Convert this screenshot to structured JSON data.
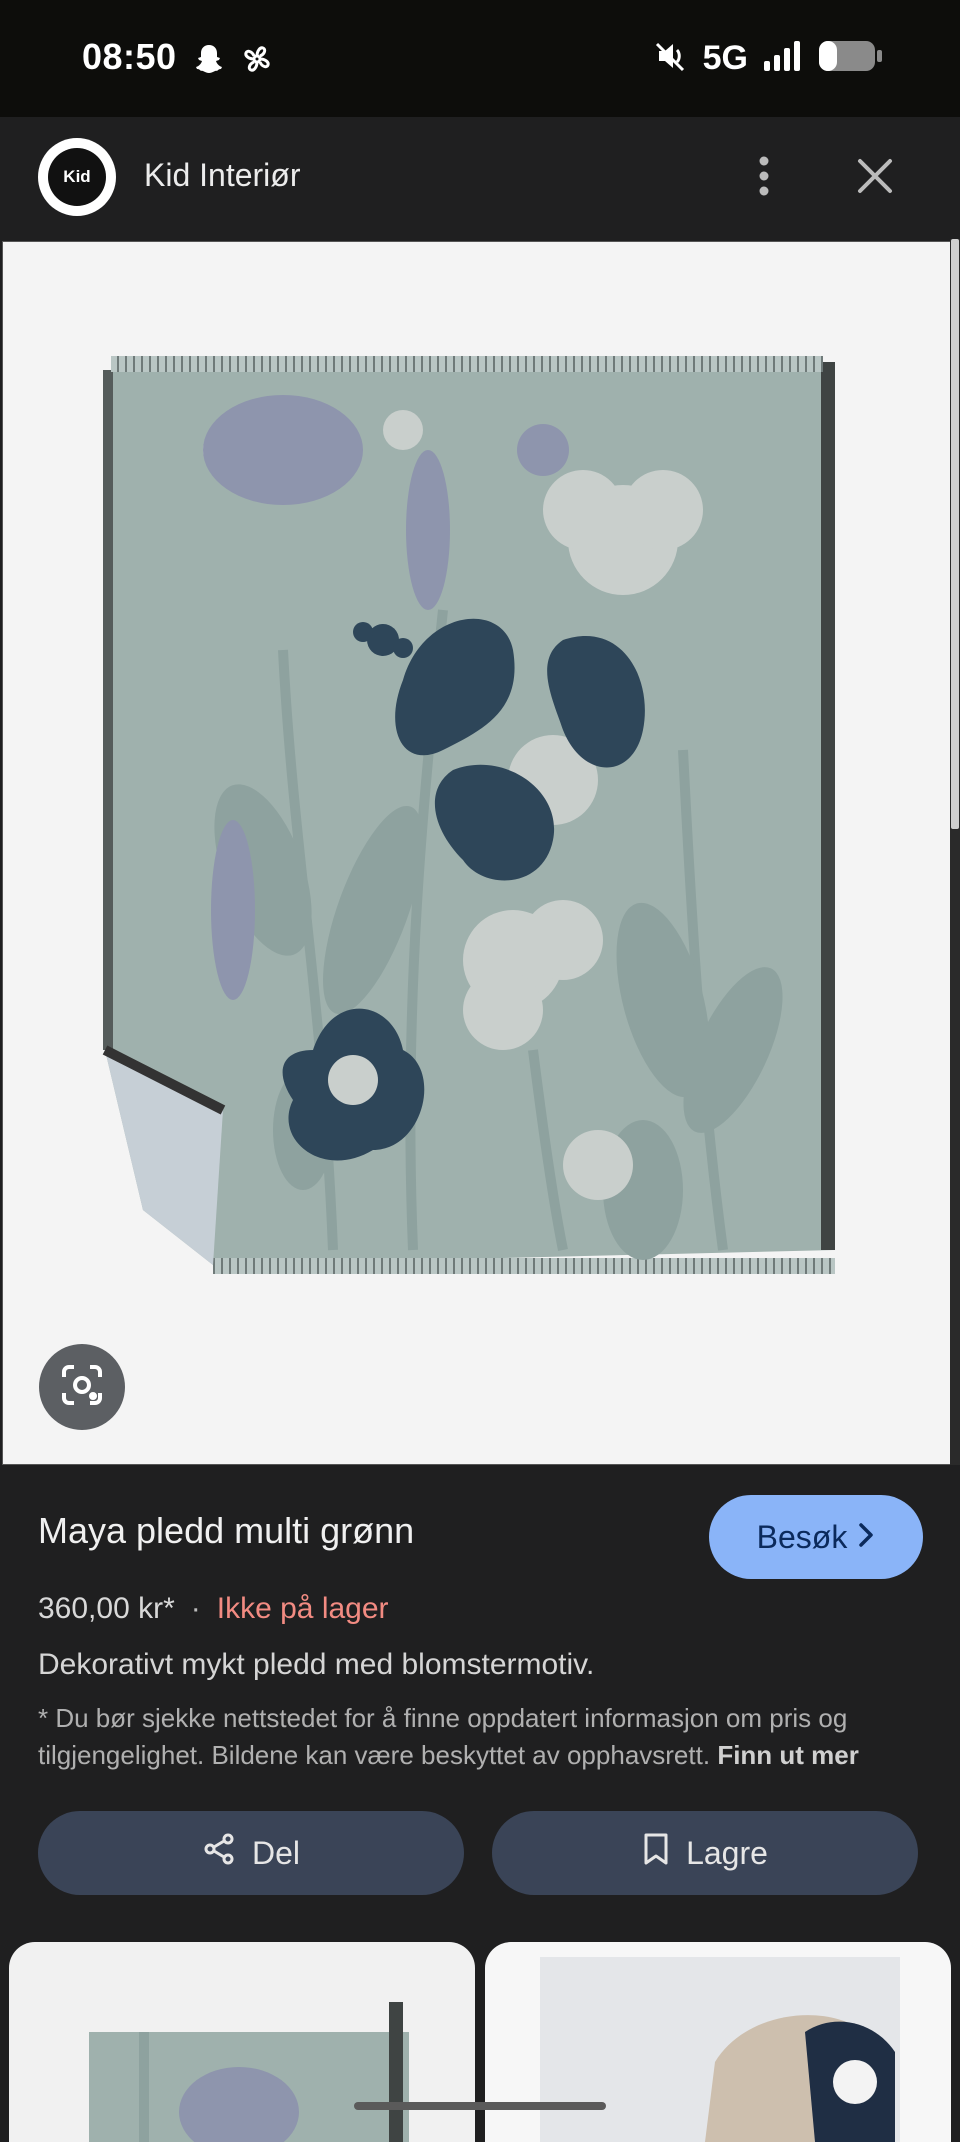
{
  "status_bar": {
    "time": "08:50",
    "network": "5G",
    "icons": [
      "snapchat-icon",
      "pinwheel-icon",
      "mute-icon",
      "signal-icon",
      "battery-icon"
    ]
  },
  "header": {
    "logo_text": "Kid",
    "brand": "Kid Interiør",
    "icons": [
      "more-vert-icon",
      "close-icon"
    ]
  },
  "product": {
    "title": "Maya pledd multi grønn",
    "visit_label": "Besøk",
    "price": "360,00 kr*",
    "separator": "·",
    "stock": "Ikke på lager",
    "description": "Dekorativt mykt pledd med blomstermotiv.",
    "disclaimer": "* Du bør sjekke nettstedet for å finne oppdatert informasjon om pris og tilgjengelighet. Bildene kan være beskyttet av opphavsrett.",
    "learn_more": "Finn ut mer"
  },
  "actions": {
    "share_label": "Del",
    "save_label": "Lagre"
  },
  "colors": {
    "accent": "#8ab4f8",
    "out_of_stock": "#f28b82",
    "action_button": "#3a4457",
    "background": "#1f1f20"
  }
}
